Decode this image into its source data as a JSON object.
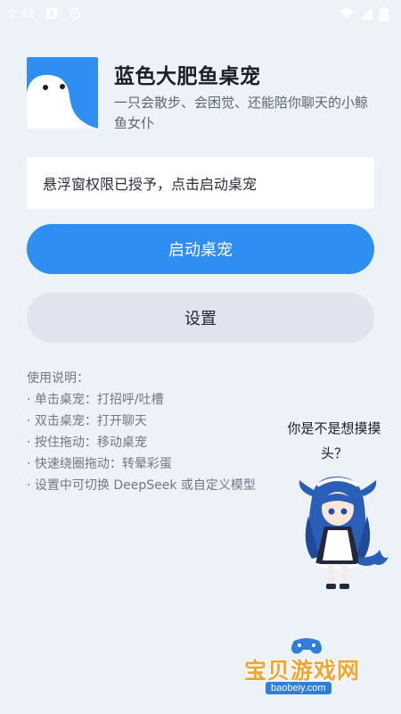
{
  "status_bar": {
    "time": "2:42",
    "icons": [
      "notification-icon",
      "settings-gear-icon",
      "wifi-icon",
      "signal-icon",
      "battery-icon"
    ]
  },
  "header": {
    "title": "蓝色大肥鱼桌宠",
    "subtitle": "一只会散步、会困觉、还能陪你聊天的小鲸鱼女仆"
  },
  "permission_status": "悬浮窗权限已授予，点击启动桌宠",
  "buttons": {
    "start": "启动桌宠",
    "settings": "设置"
  },
  "instructions": {
    "heading": "使用说明：",
    "items": [
      "· 单击桌宠：打招呼/吐槽",
      "· 双击桌宠：打开聊天",
      "· 按住拖动：移动桌宠",
      "· 快速绕圈拖动：转晕彩蛋",
      "· 设置中可切换 DeepSeek 或自定义模型"
    ]
  },
  "pet_speech": {
    "line1": "你是不是想摸摸",
    "line2": "头？"
  },
  "watermark": {
    "name": "宝贝游戏网",
    "url": "baobeiy.com"
  },
  "colors": {
    "accent": "#2f8ef2",
    "background": "#edf1f8",
    "secondary_button": "#dfe4ee",
    "watermark_orange": "#f0a630"
  }
}
